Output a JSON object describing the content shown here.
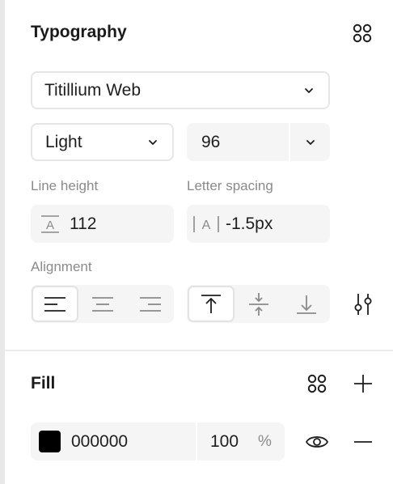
{
  "typography": {
    "title": "Typography",
    "font_family": "Titillium Web",
    "font_weight": "Light",
    "font_size": "96",
    "line_height_label": "Line height",
    "line_height_value": "112",
    "letter_spacing_label": "Letter spacing",
    "letter_spacing_value": "-1.5px",
    "alignment_label": "Alignment",
    "horizontal_alignment_selected": "left",
    "vertical_alignment_selected": "top"
  },
  "fill": {
    "title": "Fill",
    "color_hex": "000000",
    "swatch_color": "#000000",
    "opacity_value": "100",
    "opacity_unit": "%"
  },
  "icons": {
    "styles": "four-dots-icon",
    "type_settings": "sliders-icon",
    "add": "plus-icon",
    "remove": "minus-icon",
    "visibility": "eye-icon"
  }
}
